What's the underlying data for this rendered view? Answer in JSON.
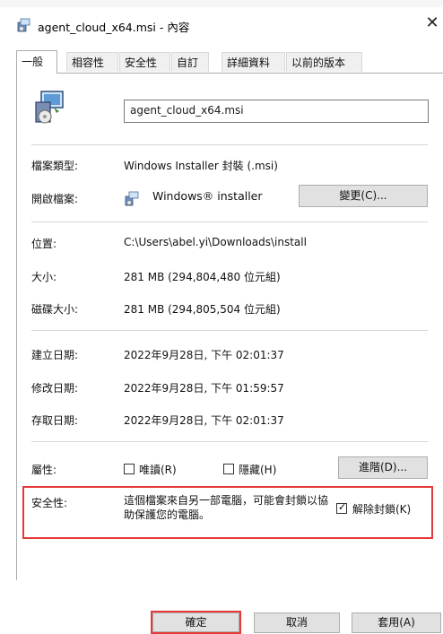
{
  "window": {
    "title": "agent_cloud_x64.msi - 內容",
    "close_glyph": "✕"
  },
  "tabs": [
    {
      "label": "一般",
      "active": true
    },
    {
      "label": "相容性",
      "active": false
    },
    {
      "label": "安全性",
      "active": false
    },
    {
      "label": "自訂",
      "active": false
    },
    {
      "label": "詳細資料",
      "active": false
    },
    {
      "label": "以前的版本",
      "active": false
    }
  ],
  "general": {
    "file_icon": "msi-package-icon",
    "filename": "agent_cloud_x64.msi",
    "type_label": "檔案類型:",
    "type_value": "Windows Installer 封裝 (.msi)",
    "opener_label": "開啟檔案:",
    "opener_icon": "windows-installer-icon",
    "opener_value": "Windows® installer",
    "change_button": "變更(C)...",
    "location_label": "位置:",
    "location_value": "C:\\Users\\abel.yi\\Downloads\\install",
    "size_label": "大小:",
    "size_value": "281 MB (294,804,480 位元組)",
    "disk_size_label": "磁碟大小:",
    "disk_size_value": "281 MB (294,805,504 位元組)",
    "created_label": "建立日期:",
    "created_value": "2022年9月28日, 下午 02:01:37",
    "modified_label": "修改日期:",
    "modified_value": "2022年9月28日, 下午 01:59:57",
    "accessed_label": "存取日期:",
    "accessed_value": "2022年9月28日, 下午 02:01:37",
    "attributes_label": "屬性:",
    "readonly_label": "唯讀(R)",
    "readonly_checked": false,
    "hidden_label": "隱藏(H)",
    "hidden_checked": false,
    "advanced_button": "進階(D)...",
    "security_label": "安全性:",
    "security_text": "這個檔案來自另一部電腦，可能會封鎖以協助保護您的電腦。",
    "unblock_label": "解除封鎖(K)",
    "unblock_checked": true
  },
  "footer": {
    "ok": "確定",
    "cancel": "取消",
    "apply": "套用(A)"
  },
  "colors": {
    "highlight": "#e53a3a",
    "button_bg": "#e1e1e1"
  }
}
